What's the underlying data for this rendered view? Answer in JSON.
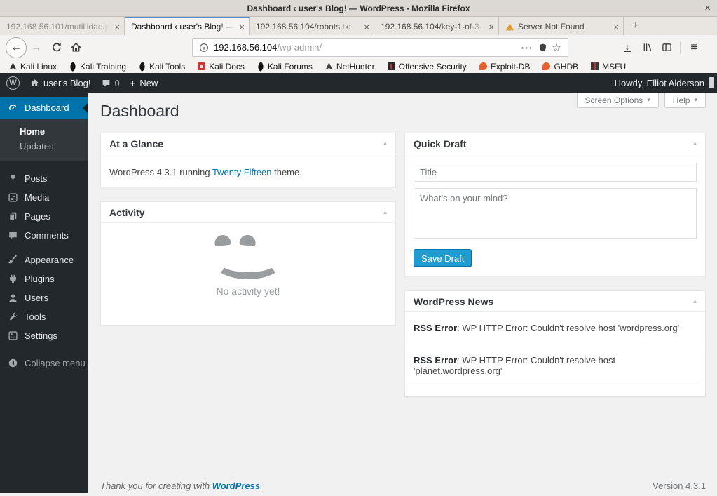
{
  "colors": {
    "firefox_accent": "#4a90d9",
    "wp_admin_bar_bg": "#23282d",
    "wp_active_menu": "#0073aa",
    "link": "#0073aa",
    "primary_button": "#219bd0",
    "content_bg": "#f1f1f1",
    "warning": "#f0a02f"
  },
  "window": {
    "title": "Dashboard ‹ user's Blog! — WordPress - Mozilla Firefox",
    "close_glyph": "×"
  },
  "tab_bar": {
    "tabs": [
      {
        "label": "192.168.56.101/mutillidae/p",
        "close_glyph": "×"
      },
      {
        "label": "Dashboard ‹ user's Blog! — ",
        "close_glyph": "×"
      },
      {
        "label": "192.168.56.104/robots.txt",
        "close_glyph": "×"
      },
      {
        "label": "192.168.56.104/key-1-of-3.",
        "close_glyph": "×"
      },
      {
        "label": "Server Not Found",
        "close_glyph": "×"
      }
    ],
    "new_tab_glyph": "+"
  },
  "nav_bar": {
    "back_glyph": "←",
    "forward_glyph": "→",
    "url": {
      "host": "192.168.56.104",
      "path": "/wp-admin/"
    },
    "overflow_glyph": "···",
    "star_glyph": "☆",
    "download_glyph": "↓",
    "menu_glyph": "≡"
  },
  "bookmarks": {
    "items": [
      {
        "label": "Kali Linux"
      },
      {
        "label": "Kali Training"
      },
      {
        "label": "Kali Tools"
      },
      {
        "label": "Kali Docs"
      },
      {
        "label": "Kali Forums"
      },
      {
        "label": "NetHunter"
      },
      {
        "label": "Offensive Security"
      },
      {
        "label": "Exploit-DB"
      },
      {
        "label": "GHDB"
      },
      {
        "label": "MSFU"
      }
    ]
  },
  "admin_bar": {
    "wp_glyph": "W",
    "site_name": "user's Blog!",
    "comment_count": "0",
    "new_glyph": "+",
    "new_label": "New",
    "howdy": "Howdy, Elliot Alderson"
  },
  "sidebar": {
    "dashboard_label": "Dashboard",
    "submenu": [
      {
        "label": "Home"
      },
      {
        "label": "Updates"
      }
    ],
    "items": [
      {
        "label": "Posts"
      },
      {
        "label": "Media"
      },
      {
        "label": "Pages"
      },
      {
        "label": "Comments"
      },
      {
        "label": "Appearance"
      },
      {
        "label": "Plugins"
      },
      {
        "label": "Users"
      },
      {
        "label": "Tools"
      },
      {
        "label": "Settings"
      }
    ],
    "collapse_label": "Collapse menu"
  },
  "main": {
    "page_title": "Dashboard",
    "screen_options_label": "Screen Options",
    "help_label": "Help",
    "dropdown_glyph": "▾",
    "widget_collapse_glyph": "▴",
    "at_a_glance": {
      "title": "At a Glance",
      "text_before": "WordPress 4.3.1 running ",
      "theme_link": "Twenty Fifteen",
      "text_after": " theme."
    },
    "activity": {
      "title": "Activity",
      "empty_message": "No activity yet!"
    },
    "quick_draft": {
      "title": "Quick Draft",
      "title_placeholder": "Title",
      "content_placeholder": "What’s on your mind?",
      "save_label": "Save Draft"
    },
    "news": {
      "title": "WordPress News",
      "items": [
        {
          "prefix": "RSS Error",
          "message": ": WP HTTP Error: Couldn't resolve host 'wordpress.org'"
        },
        {
          "prefix": "RSS Error",
          "message": ": WP HTTP Error: Couldn't resolve host 'planet.wordpress.org'"
        }
      ]
    }
  },
  "footer": {
    "thanks_before": "Thank you for creating with ",
    "link_label": "WordPress",
    "thanks_after": ".",
    "version": "Version 4.3.1"
  }
}
